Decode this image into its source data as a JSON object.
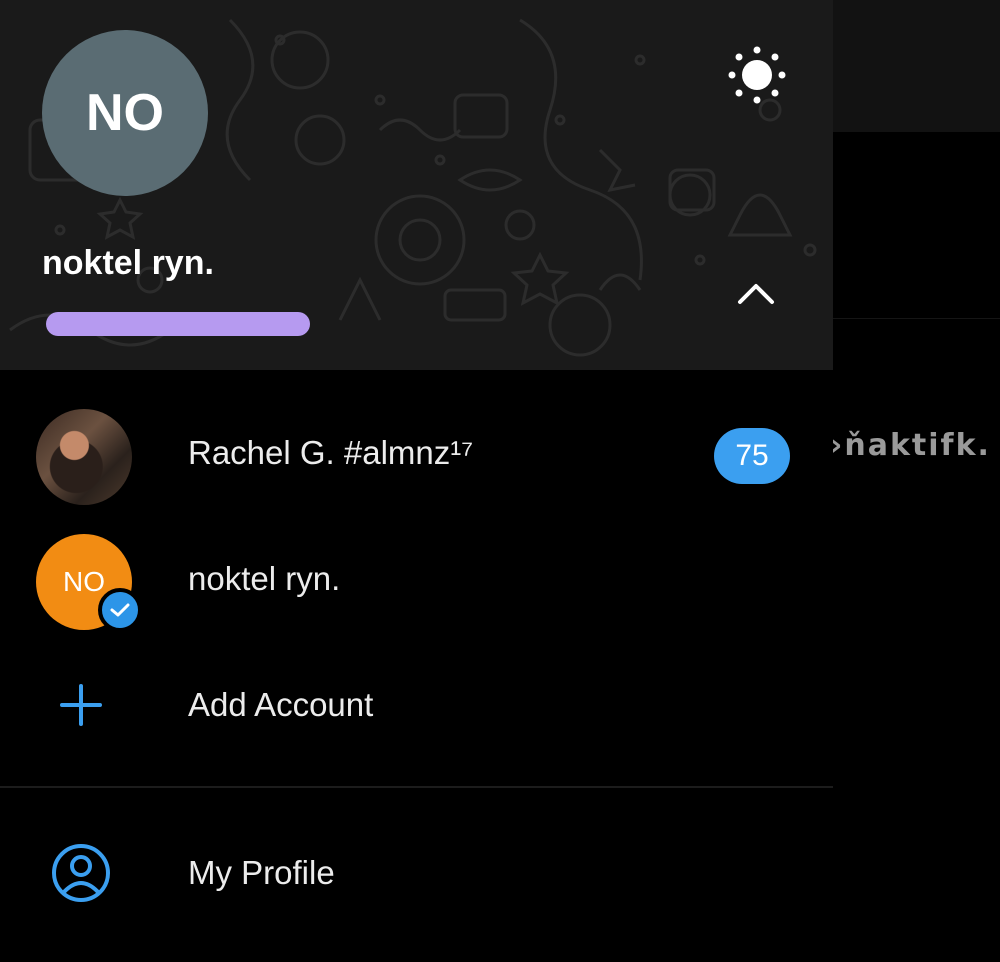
{
  "header": {
    "avatar_initials": "NO",
    "avatar_color": "#5a6c73",
    "account_name": "noktel ryn.",
    "theme_toggle_icon": "sun-icon",
    "collapse_icon": "chevron-up-icon"
  },
  "accounts": [
    {
      "name": "Rachel G. #almnz¹⁷",
      "avatar": "photo",
      "unread_count": "75"
    },
    {
      "name": "noktel ryn.",
      "avatar_initials": "NO",
      "avatar_color": "#f28c13",
      "verified": true
    }
  ],
  "add_account": {
    "label": "Add Account",
    "icon": "plus-icon"
  },
  "menu": [
    {
      "label": "My Profile",
      "icon": "user-circle-icon"
    }
  ],
  "background_chat": {
    "partial_text": "›ňaktifk."
  },
  "colors": {
    "accent": "#3b9ff0",
    "badge": "#3b9ff0",
    "verified": "#2c95e8",
    "header_bg": "#1a1a1a"
  }
}
